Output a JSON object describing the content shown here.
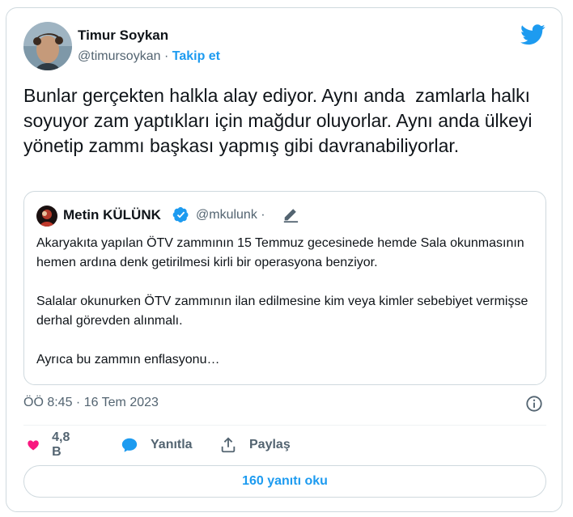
{
  "colors": {
    "accent": "#1d9bf0",
    "like": "#f91880",
    "muted": "#536471",
    "text": "#0f1419",
    "border": "#cfd9de"
  },
  "author": {
    "name": "Timur Soykan",
    "handle": "@timursoykan",
    "separator": "·",
    "follow_label": "Takip et"
  },
  "tweet": {
    "text": "Bunlar gerçekten halkla alay ediyor. Aynı anda  zamlarla halkı soyuyor zam yaptıkları için mağdur oluyorlar. Aynı anda ülkeyi yönetip zammı başkası yapmış gibi davranabiliyorlar."
  },
  "quote": {
    "name": "Metin KÜLÜNK",
    "handle": "@mkulunk",
    "separator": "·",
    "text": "Akaryakıta yapılan ÖTV zammının 15 Temmuz gecesinede hemde Sala okunmasının hemen ardına denk getirilmesi kirli bir operasyona benziyor.\n\nSalalar okunurken ÖTV zammının ilan edilmesine kim veya kimler sebebiyet vermişse derhal görevden alınmalı.\n\nAyrıca bu zammın enflasyonu…"
  },
  "meta": {
    "timestamp": "ÖÖ 8:45 · 16 Tem 2023"
  },
  "actions": {
    "likes": "4,8 B",
    "reply_label": "Yanıtla",
    "share_label": "Paylaş"
  },
  "cta": {
    "label": "160 yanıtı oku"
  },
  "icons": {
    "logo": "twitter-bird-icon",
    "like": "heart-icon",
    "reply": "speech-bubble-icon",
    "share": "share-icon",
    "info": "info-icon",
    "verified": "verified-badge-icon",
    "edit": "pencil-icon"
  }
}
